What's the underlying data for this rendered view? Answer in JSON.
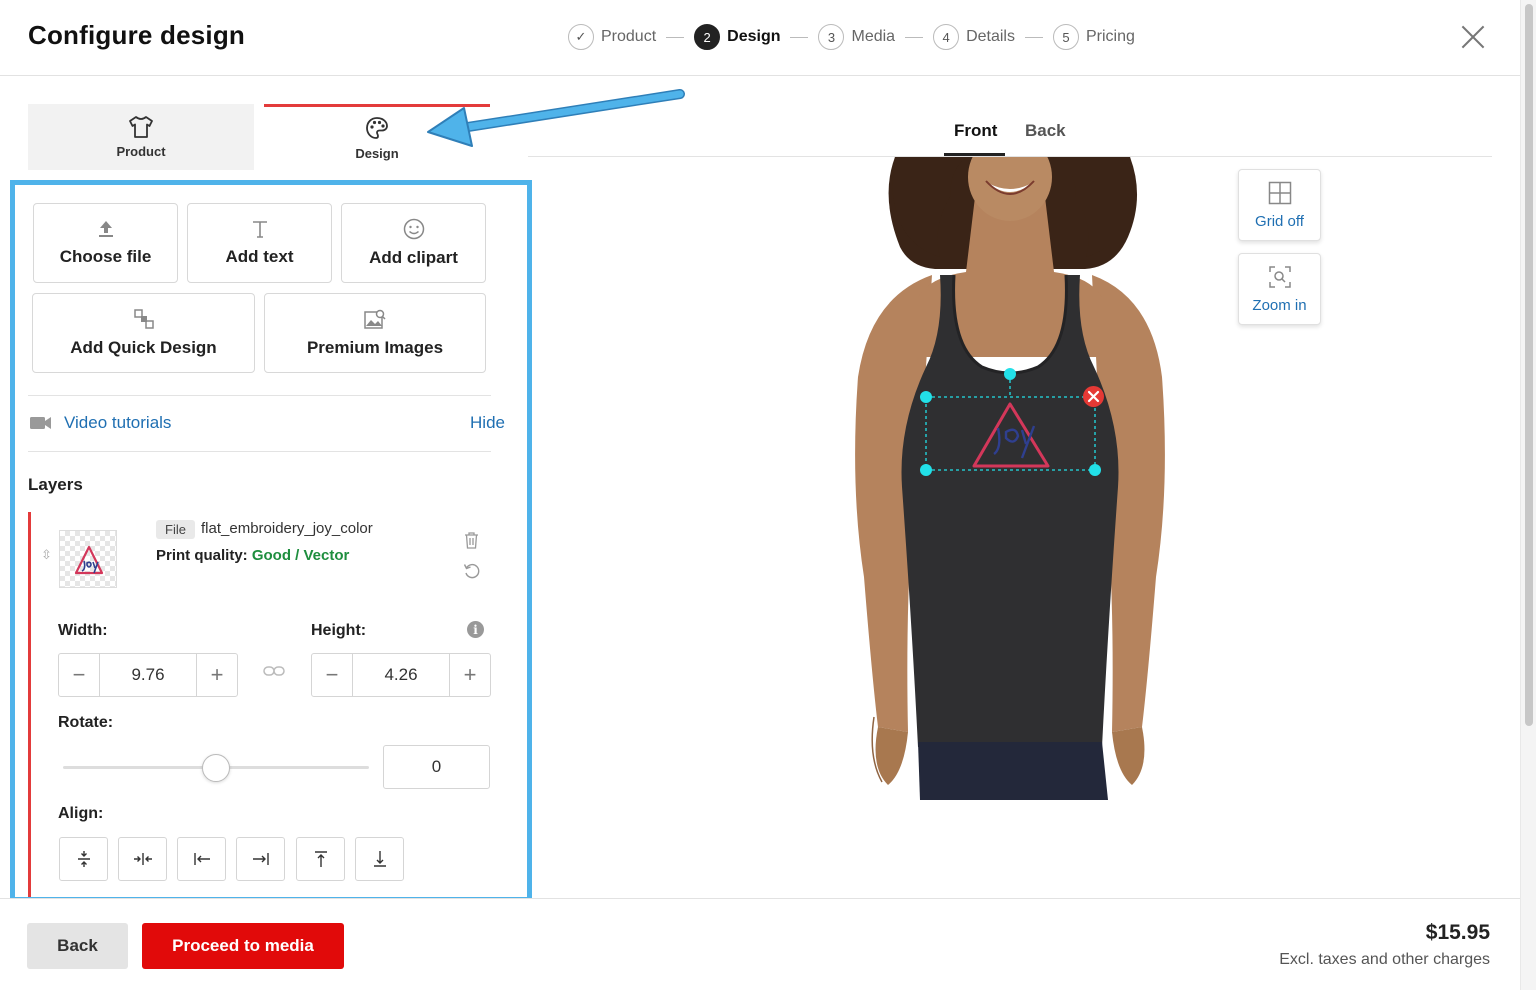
{
  "header": {
    "title": "Configure design",
    "steps": [
      {
        "num": "✓",
        "label": "Product"
      },
      {
        "num": "2",
        "label": "Design"
      },
      {
        "num": "3",
        "label": "Media"
      },
      {
        "num": "4",
        "label": "Details"
      },
      {
        "num": "5",
        "label": "Pricing"
      }
    ]
  },
  "left_tabs": [
    {
      "label": "Product",
      "icon": "tshirt-icon"
    },
    {
      "label": "Design",
      "icon": "palette-icon"
    }
  ],
  "tools": {
    "choose_file": "Choose file",
    "add_text": "Add text",
    "add_clipart": "Add clipart",
    "add_quick_design": "Add Quick Design",
    "premium_images": "Premium Images"
  },
  "video": {
    "label": "Video tutorials",
    "hide": "Hide"
  },
  "layers": {
    "title": "Layers",
    "file_chip": "File",
    "file_name": "flat_embroidery_joy_color",
    "print_quality_label": "Print quality:",
    "print_quality_value": "Good / Vector",
    "width_label": "Width:",
    "width_value": "9.76",
    "height_label": "Height:",
    "height_value": "4.26",
    "rotate_label": "Rotate:",
    "rotate_value": "0",
    "rotate_fraction": 0.5,
    "align_label": "Align:"
  },
  "preview": {
    "tabs": [
      "Front",
      "Back"
    ],
    "active_tab": "Front",
    "grid_label": "Grid off",
    "zoom_label": "Zoom in",
    "design_text": "joy"
  },
  "footer": {
    "back": "Back",
    "proceed": "Proceed to media",
    "price": "$15.95",
    "price_note": "Excl. taxes and other charges"
  },
  "colors": {
    "accent_red": "#e10a0a",
    "highlight_blue": "#4fb3ea",
    "link_blue": "#1f6fb2",
    "quality_green": "#1e8e3e",
    "handle_cyan": "#22e0e8"
  }
}
